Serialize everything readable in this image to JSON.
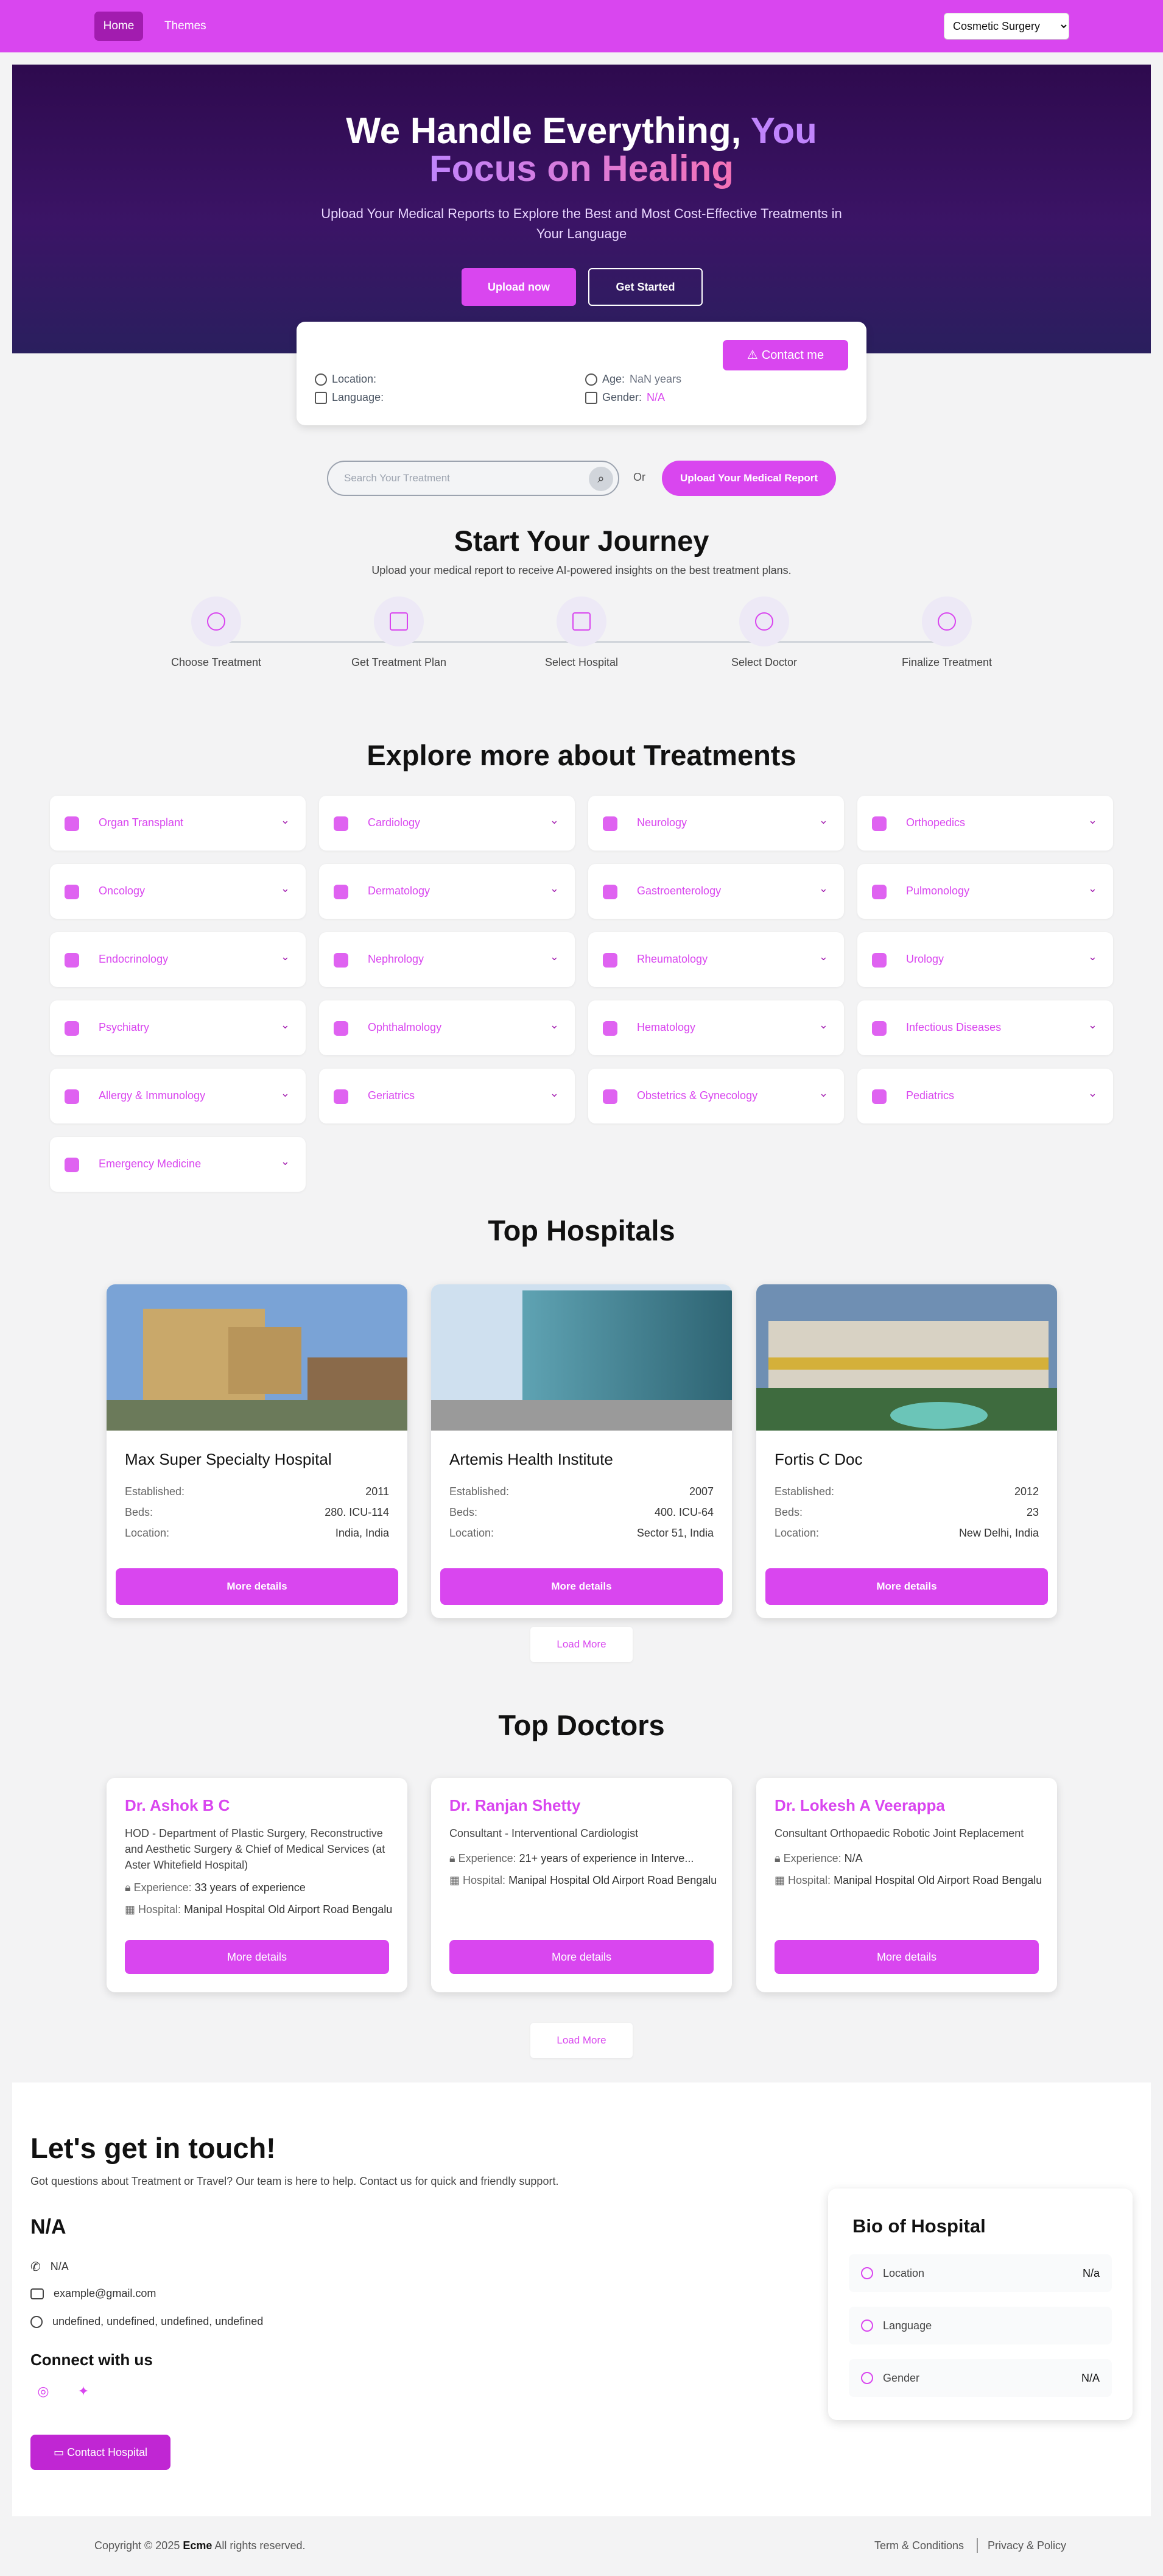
{
  "nav": {
    "home": "Home",
    "themes": "Themes",
    "select_value": "Cosmetic Surgery"
  },
  "hero": {
    "title_part1": "We Handle Everything, ",
    "title_part2": "You",
    "title_part3": "Focus on Healing",
    "subtitle": "Upload Your Medical Reports to Explore the Best and Most Cost-Effective Treatments in Your Language",
    "upload": "Upload now",
    "start": "Get Started"
  },
  "info": {
    "contact": "Contact me",
    "location_label": "Location:",
    "language_label": "Language:",
    "age_label": "Age:",
    "age_value": "NaN years",
    "gender_label": "Gender:",
    "gender_value": "N/A"
  },
  "search": {
    "placeholder": "Search Your Treatment",
    "or": "Or",
    "report": "Upload Your Medical Report"
  },
  "journey": {
    "title": "Start Your Journey",
    "subtitle": "Upload your medical report to receive AI-powered insights on the best treatment plans.",
    "steps": [
      "Choose Treatment",
      "Get Treatment Plan",
      "Select Hospital",
      "Select Doctor",
      "Finalize Treatment"
    ]
  },
  "treatments": {
    "title": "Explore more about Treatments",
    "items": [
      "Organ Transplant",
      "Cardiology",
      "Neurology",
      "Orthopedics",
      "Oncology",
      "Dermatology",
      "Gastroenterology",
      "Pulmonology",
      "Endocrinology",
      "Nephrology",
      "Rheumatology",
      "Urology",
      "Psychiatry",
      "Ophthalmology",
      "Hematology",
      "Infectious Diseases",
      "Allergy & Immunology",
      "Geriatrics",
      "Obstetrics & Gynecology",
      "Pediatrics",
      "Emergency Medicine"
    ]
  },
  "hospitals": {
    "title": "Top Hospitals",
    "established_label": "Established:",
    "beds_label": "Beds:",
    "location_label": "Location:",
    "more": "More details",
    "load_more": "Load More",
    "items": [
      {
        "name": "Max Super Specialty Hospital",
        "established": "2011",
        "beds": "280. ICU-114",
        "location": "India, India"
      },
      {
        "name": "Artemis Health Institute",
        "established": "2007",
        "beds": "400. ICU-64",
        "location": "Sector 51, India"
      },
      {
        "name": "Fortis C Doc",
        "established": "2012",
        "beds": "23",
        "location": "New Delhi, India"
      }
    ]
  },
  "doctors": {
    "title": "Top Doctors",
    "experience_label": "Experience:",
    "hospital_label": "Hospital:",
    "more": "More details",
    "load_more": "Load More",
    "items": [
      {
        "name": "Dr. Ashok B C",
        "role": "HOD - Department of Plastic Surgery, Reconstructive and Aesthetic Surgery & Chief of Medical Services (at Aster Whitefield Hospital)",
        "experience": "33 years of experience",
        "hospital": "Manipal Hospital Old Airport Road Bengaluru"
      },
      {
        "name": "Dr. Ranjan Shetty",
        "role": "Consultant - Interventional Cardiologist",
        "experience": "21+ years of experience in Interve...",
        "hospital": "Manipal Hospital Old Airport Road Bengaluru"
      },
      {
        "name": "Dr. Lokesh A Veerappa",
        "role": "Consultant Orthopaedic Robotic Joint Replacement",
        "experience": "N/A",
        "hospital": "Manipal Hospital Old Airport Road Bengaluru"
      }
    ]
  },
  "contact": {
    "title": "Let's get in touch!",
    "subtitle": "Got questions about Treatment or Travel? Our team is here to help. Contact us for quick and friendly support.",
    "name": "N/A",
    "phone": "N/A",
    "email": "example@gmail.com",
    "address": "undefined, undefined, undefined, undefined",
    "connect": "Connect with us",
    "button": "Contact Hospital"
  },
  "bio": {
    "title": "Bio of Hospital",
    "location_label": "Location",
    "location_value": "N/a",
    "language_label": "Language",
    "gender_label": "Gender",
    "gender_value": "N/A"
  },
  "footer": {
    "copyright_prefix": "Copyright © 2025 ",
    "brand": "Ecme",
    "copyright_suffix": " All rights reserved.",
    "terms": "Term & Conditions",
    "privacy": "Privacy & Policy"
  },
  "colors": {
    "accent": "#d946ef",
    "hero_dark": "#2e0a4e"
  }
}
